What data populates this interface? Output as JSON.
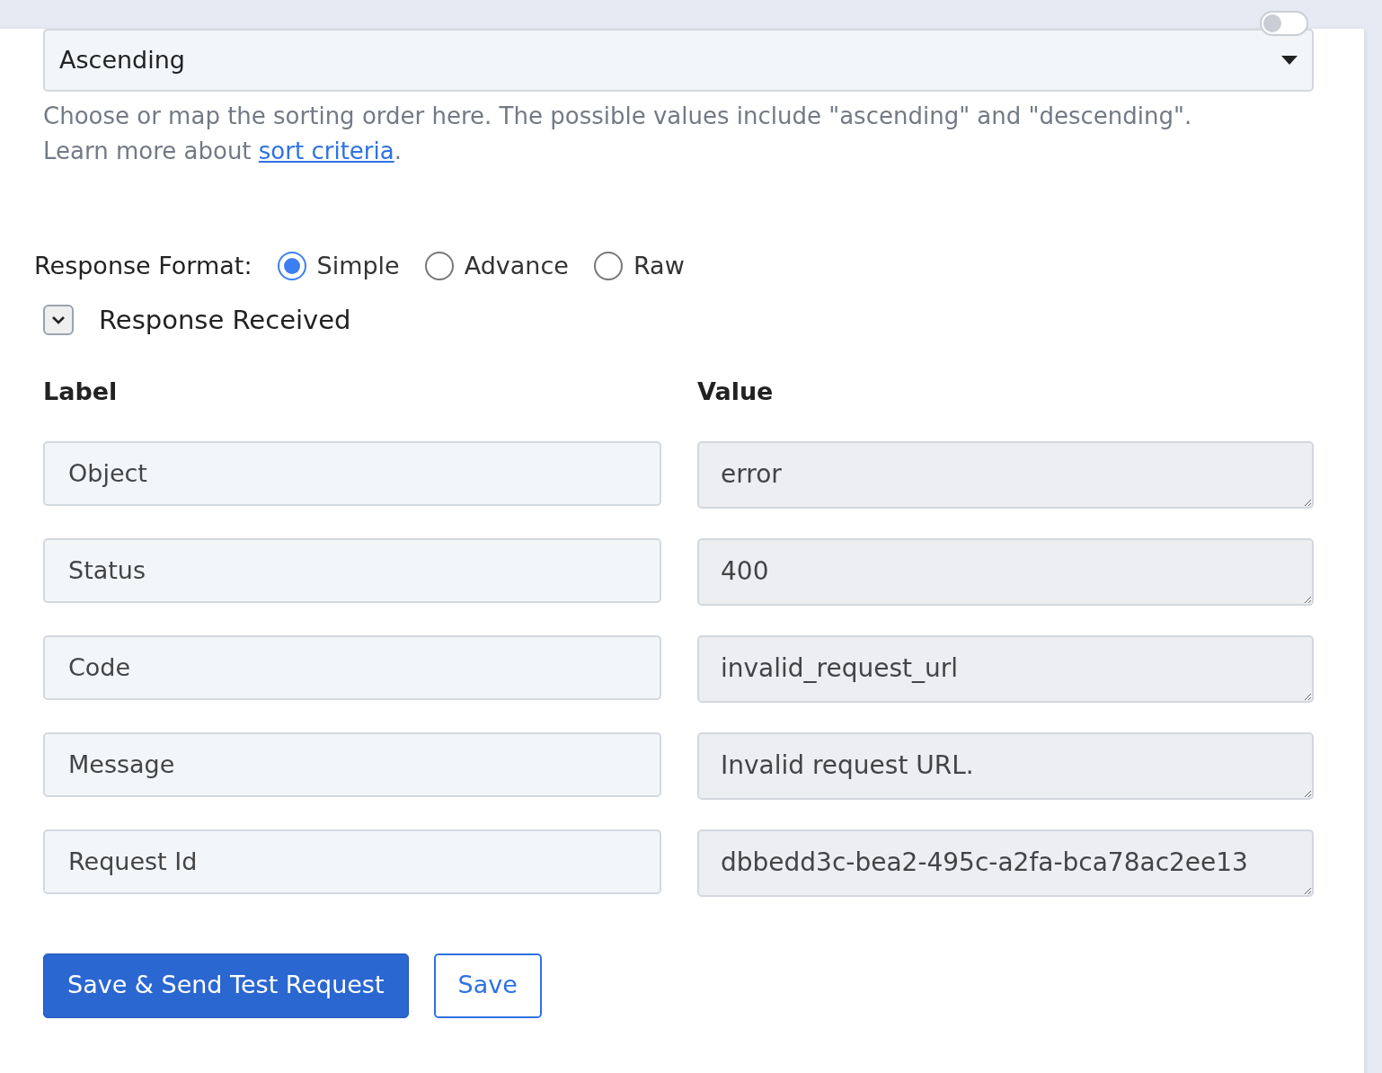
{
  "map_toggle": {
    "on": false
  },
  "sorting_order": {
    "value": "Ascending",
    "help": "Choose or map the sorting order here. The possible values include \"ascending\" and \"descending\".",
    "learn_prefix": "Learn more about ",
    "learn_link": "sort criteria",
    "learn_suffix": "."
  },
  "response_format": {
    "label": "Response Format:",
    "options": [
      {
        "label": "Simple",
        "selected": true
      },
      {
        "label": "Advance",
        "selected": false
      },
      {
        "label": "Raw",
        "selected": false
      }
    ]
  },
  "response_received": {
    "title": "Response Received",
    "expanded": true
  },
  "table": {
    "columns": [
      "Label",
      "Value"
    ],
    "rows": [
      {
        "label": "Object",
        "value": "error"
      },
      {
        "label": "Status",
        "value": "400"
      },
      {
        "label": "Code",
        "value": "invalid_request_url"
      },
      {
        "label": "Message",
        "value": "Invalid request URL."
      },
      {
        "label": "Request Id",
        "value": "dbbedd3c-bea2-495c-a2fa-bca78ac2ee13"
      }
    ]
  },
  "buttons": [
    {
      "label": "Save & Send Test Request",
      "kind": "primary"
    },
    {
      "label": "Save",
      "kind": "outline"
    }
  ]
}
